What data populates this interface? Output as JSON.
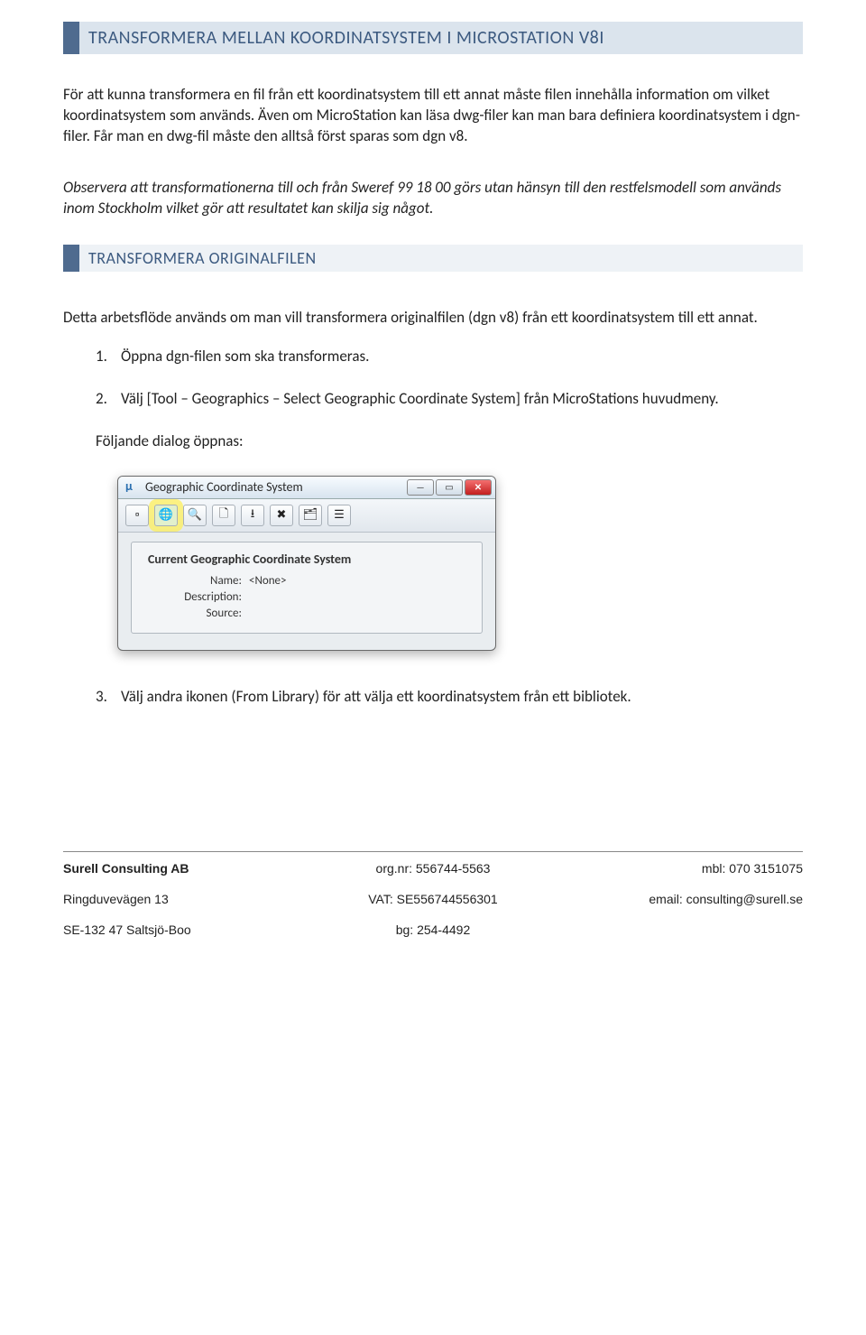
{
  "header": {
    "title": "TRANSFORMERA MELLAN KOORDINATSYSTEM I MICROSTATION V8I"
  },
  "intro": {
    "p1": "För att kunna transformera en fil från ett koordinatsystem till ett annat måste filen innehålla information om vilket koordinatsystem som används. Även om MicroStation kan läsa dwg-filer kan man bara definiera koordinatsystem i dgn-filer. Får man en dwg-fil måste den alltså först sparas som dgn v8.",
    "p2": "Observera att transformationerna till och från Sweref 99 18 00 görs utan hänsyn till den restfelsmodell som används inom Stockholm vilket gör att resultatet kan skilja sig något."
  },
  "section": {
    "title": "TRANSFORMERA ORIGINALFILEN",
    "p1": "Detta arbetsflöde används om man vill transformera originalfilen (dgn v8) från ett koordinatsystem till ett annat.",
    "items": [
      {
        "num": "1.",
        "text": "Öppna dgn-filen som ska transformeras."
      },
      {
        "num": "2.",
        "text": "Välj [Tool – Geographics – Select Geographic Coordinate System] från MicroStations huvudmeny."
      }
    ],
    "dialog_intro": "Följande dialog öppnas:",
    "item3": {
      "num": "3.",
      "text": "Välj andra ikonen (From Library) för att välja ett koordinatsystem från ett bibliotek."
    }
  },
  "dialog": {
    "app_icon_glyph": "µ",
    "title": "Geographic Coordinate System",
    "group_title": "Current Geographic Coordinate System",
    "rows": {
      "name_label": "Name:",
      "name_value": "<None>",
      "desc_label": "Description:",
      "desc_value": "",
      "source_label": "Source:",
      "source_value": ""
    },
    "toolbar": [
      {
        "name": "tool-dialog",
        "glyph": "▫",
        "highlighted": false
      },
      {
        "name": "tool-from-library",
        "glyph": "🌐",
        "highlighted": true
      },
      {
        "name": "tool-search",
        "glyph": "🔍",
        "highlighted": false
      },
      {
        "name": "tool-file",
        "glyph": "🗋",
        "highlighted": false
      },
      {
        "name": "tool-import",
        "glyph": "⭳",
        "highlighted": false
      },
      {
        "name": "tool-delete",
        "glyph": "✖",
        "highlighted": false
      },
      {
        "name": "tool-edit",
        "glyph": "🗂",
        "highlighted": false
      },
      {
        "name": "tool-details",
        "glyph": "☰",
        "highlighted": false
      }
    ]
  },
  "footer": {
    "company": "Surell Consulting AB",
    "org_label": "org.nr: 556744-5563",
    "mobile": "mbl: 070 3151075",
    "address": "Ringduvevägen 13",
    "vat": "VAT: SE556744556301",
    "email": "email: consulting@surell.se",
    "postal": "SE-132 47 Saltsjö-Boo",
    "bg": "bg: 254-4492"
  }
}
